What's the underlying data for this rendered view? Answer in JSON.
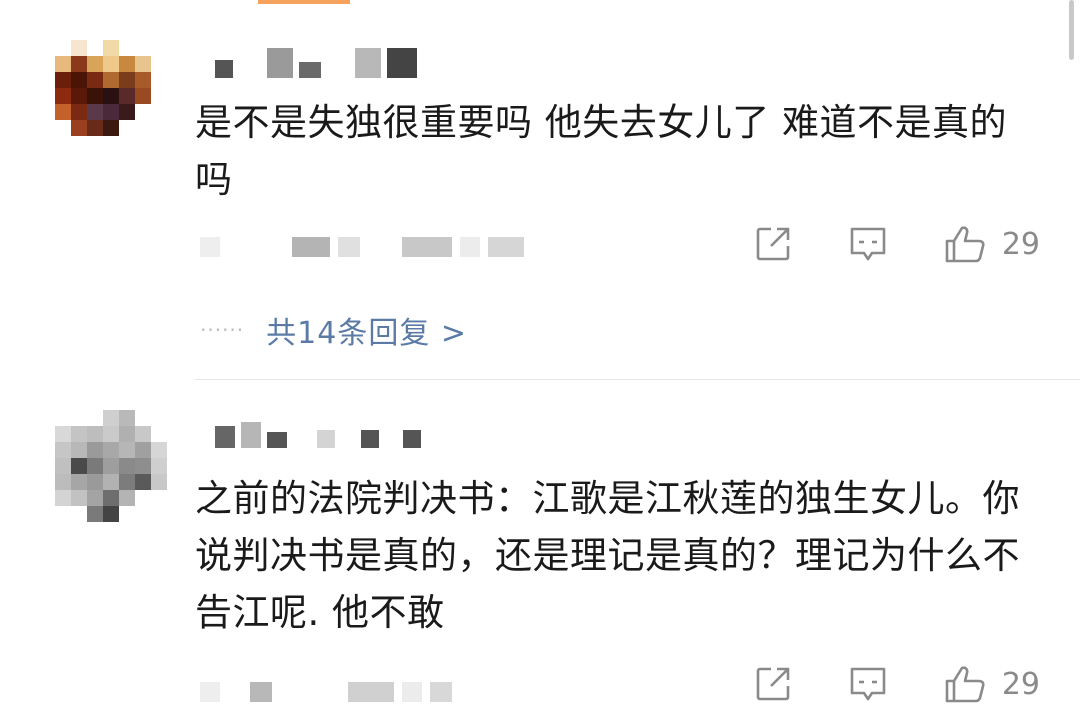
{
  "comments": [
    {
      "text": "是不是失独很重要吗  他失去女儿了 难道不是真的吗",
      "likes": "29",
      "replies_label": "共14条回复 >",
      "replies_dots": "······"
    },
    {
      "text": "之前的法院判决书：江歌是江秋莲的独生女儿。你说判决书是真的，还是理记是真的？理记为什么不告江呢. 他不敢",
      "likes": "29"
    }
  ],
  "icons": {
    "share": "share-icon",
    "comment": "comment-icon",
    "like": "thumbs-up-icon"
  },
  "colors": {
    "text": "#1a1a1a",
    "meta_gray": "#8a8a8a",
    "reply_link": "#5b7ba6",
    "divider": "#e6e6e6",
    "top_tab_accent": "#f5a25d"
  }
}
